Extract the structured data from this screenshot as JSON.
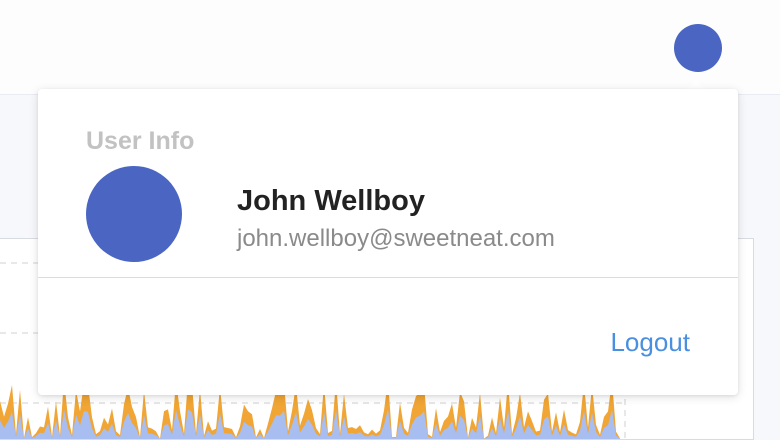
{
  "header": {
    "avatar_icon": "user-avatar-icon"
  },
  "user_menu": {
    "section_title": "User Info",
    "name": "John Wellboy",
    "email": "john.wellboy@sweetneat.com",
    "logout_label": "Logout"
  },
  "colors": {
    "avatar": "#4a66c2",
    "link": "#4a8fe0",
    "chart_primary": "#f0a534",
    "chart_secondary": "#a8bdf0"
  }
}
